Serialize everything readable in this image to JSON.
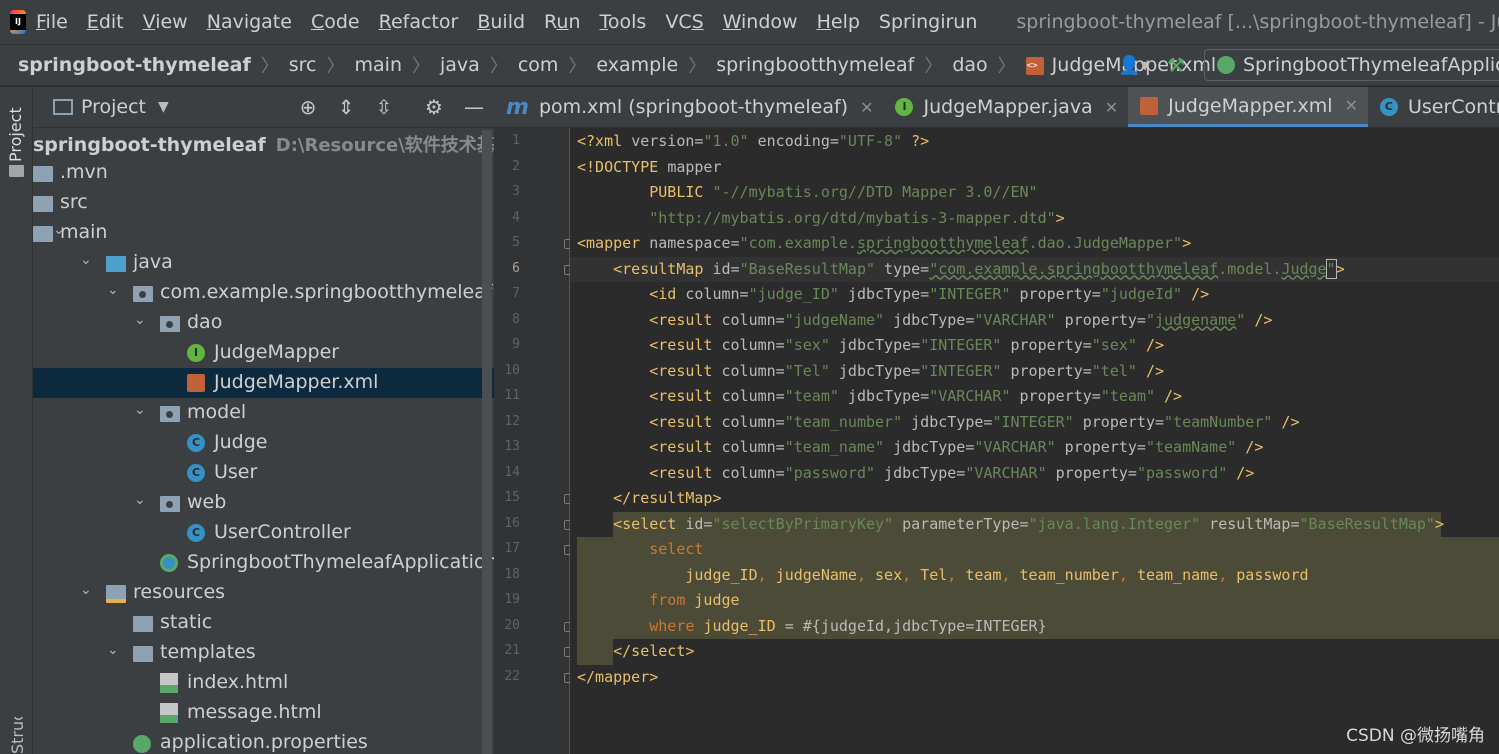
{
  "menubar": {
    "items": [
      {
        "pre": "",
        "u": "F",
        "post": "ile"
      },
      {
        "pre": "",
        "u": "E",
        "post": "dit"
      },
      {
        "pre": "",
        "u": "V",
        "post": "iew"
      },
      {
        "pre": "",
        "u": "N",
        "post": "avigate"
      },
      {
        "pre": "",
        "u": "C",
        "post": "ode"
      },
      {
        "pre": "",
        "u": "R",
        "post": "efactor"
      },
      {
        "pre": "",
        "u": "B",
        "post": "uild"
      },
      {
        "pre": "R",
        "u": "u",
        "post": "n"
      },
      {
        "pre": "",
        "u": "T",
        "post": "ools"
      },
      {
        "pre": "VC",
        "u": "S",
        "post": ""
      },
      {
        "pre": "",
        "u": "W",
        "post": "indow"
      },
      {
        "pre": "",
        "u": "H",
        "post": "elp"
      },
      {
        "pre": "Springirun",
        "u": "",
        "post": ""
      }
    ],
    "window_title": "springboot-thymeleaf [...\\springboot-thymeleaf] - JudgeMapper.xml"
  },
  "breadcrumb": [
    "springboot-thymeleaf",
    "src",
    "main",
    "java",
    "com",
    "example",
    "springbootthymeleaf",
    "dao",
    "JudgeMapper.xml"
  ],
  "run_config": "SpringbootThymeleafApplication",
  "strip": {
    "project": "Project",
    "structure": "Structure"
  },
  "project_panel": {
    "title": "Project",
    "tree": [
      {
        "label": "springboot-thymeleaf",
        "path": "D:\\Resource\\软件技术基础\\java",
        "indent": 0,
        "arrow": "",
        "icon": "none",
        "bold": true
      },
      {
        "label": ".mvn",
        "indent": 0,
        "arrow": "",
        "icon": "folder"
      },
      {
        "label": "src",
        "indent": 0,
        "arrow": "",
        "icon": "folder"
      },
      {
        "label": "main",
        "indent": 0,
        "arrow": "⌄",
        "icon": "folder"
      },
      {
        "label": "java",
        "indent": 1,
        "arrow": "⌄",
        "icon": "folder-blue"
      },
      {
        "label": "com.example.springbootthymeleaf",
        "indent": 2,
        "arrow": "⌄",
        "icon": "pkg"
      },
      {
        "label": "dao",
        "indent": 3,
        "arrow": "⌄",
        "icon": "pkg"
      },
      {
        "label": "JudgeMapper",
        "indent": 4,
        "arrow": "",
        "icon": "iface"
      },
      {
        "label": "JudgeMapper.xml",
        "indent": 4,
        "arrow": "",
        "icon": "xml",
        "selected": true
      },
      {
        "label": "model",
        "indent": 3,
        "arrow": "⌄",
        "icon": "pkg"
      },
      {
        "label": "Judge",
        "indent": 4,
        "arrow": "",
        "icon": "cls"
      },
      {
        "label": "User",
        "indent": 4,
        "arrow": "",
        "icon": "cls"
      },
      {
        "label": "web",
        "indent": 3,
        "arrow": "⌄",
        "icon": "pkg"
      },
      {
        "label": "UserController",
        "indent": 4,
        "arrow": "",
        "icon": "cls"
      },
      {
        "label": "SpringbootThymeleafApplication",
        "indent": 3,
        "arrow": "",
        "icon": "app"
      },
      {
        "label": "resources",
        "indent": 1,
        "arrow": "⌄",
        "icon": "res"
      },
      {
        "label": "static",
        "indent": 2,
        "arrow": "",
        "icon": "folder"
      },
      {
        "label": "templates",
        "indent": 2,
        "arrow": "⌄",
        "icon": "folder"
      },
      {
        "label": "index.html",
        "indent": 3,
        "arrow": "",
        "icon": "html"
      },
      {
        "label": "message.html",
        "indent": 3,
        "arrow": "",
        "icon": "html"
      },
      {
        "label": "application.properties",
        "indent": 2,
        "arrow": "",
        "icon": "props"
      }
    ]
  },
  "editor": {
    "tabs": [
      {
        "label": "pom.xml (springboot-thymeleaf)",
        "icon": "m",
        "active": false
      },
      {
        "label": "JudgeMapper.java",
        "icon": "iface",
        "active": false
      },
      {
        "label": "JudgeMapper.xml",
        "icon": "xml",
        "active": true
      },
      {
        "label": "UserController.java",
        "icon": "cls",
        "active": false
      }
    ],
    "current_line": 6,
    "highlight_lines": [
      17,
      20
    ],
    "lines": [
      {
        "n": "1",
        "segs": [
          [
            "t",
            "<?xml "
          ],
          [
            "a",
            "version="
          ],
          [
            "v",
            "\"1.0\""
          ],
          [
            "a",
            " encoding="
          ],
          [
            "v",
            "\"UTF-8\""
          ],
          [
            "t",
            " ?>"
          ]
        ]
      },
      {
        "n": "2",
        "segs": [
          [
            "t",
            "<!DOCTYPE "
          ],
          [
            "a",
            "mapper"
          ]
        ]
      },
      {
        "n": "3",
        "segs": [
          [
            "a",
            "        "
          ],
          [
            "t",
            "PUBLIC "
          ],
          [
            "v",
            "\"-//mybatis.org//DTD Mapper 3.0//EN\""
          ]
        ]
      },
      {
        "n": "4",
        "segs": [
          [
            "a",
            "        "
          ],
          [
            "v",
            "\"http://mybatis.org/dtd/mybatis-3-mapper.dtd\""
          ],
          [
            "t",
            ">"
          ]
        ]
      },
      {
        "n": "5",
        "segs": [
          [
            "t",
            "<mapper "
          ],
          [
            "a",
            "namespace="
          ],
          [
            "v",
            "\"com.example."
          ],
          [
            "vs",
            "springbootthymeleaf"
          ],
          [
            "v",
            ".dao.JudgeMapper\""
          ],
          [
            "t",
            ">"
          ]
        ]
      },
      {
        "n": "6",
        "segs": [
          [
            "a",
            "    "
          ],
          [
            "t",
            "<resultMap "
          ],
          [
            "a",
            "id="
          ],
          [
            "v",
            "\"BaseResultMap\""
          ],
          [
            "a",
            " type="
          ],
          [
            "vs",
            "\"com.example."
          ],
          [
            "vs",
            "springbootthymeleaf"
          ],
          [
            "v",
            ".model."
          ],
          [
            "vs",
            "Judge"
          ],
          [
            "vc",
            "\""
          ],
          [
            "t",
            ">"
          ]
        ]
      },
      {
        "n": "7",
        "segs": [
          [
            "a",
            "        "
          ],
          [
            "t",
            "<id "
          ],
          [
            "a",
            "column="
          ],
          [
            "v",
            "\"judge_ID\""
          ],
          [
            "a",
            " jdbcType="
          ],
          [
            "v",
            "\"INTEGER\""
          ],
          [
            "a",
            " property="
          ],
          [
            "v",
            "\"judgeId\""
          ],
          [
            "t",
            " />"
          ]
        ]
      },
      {
        "n": "8",
        "segs": [
          [
            "a",
            "        "
          ],
          [
            "t",
            "<result "
          ],
          [
            "a",
            "column="
          ],
          [
            "v",
            "\"judgeName\""
          ],
          [
            "a",
            " jdbcType="
          ],
          [
            "v",
            "\"VARCHAR\""
          ],
          [
            "a",
            " property="
          ],
          [
            "v",
            "\""
          ],
          [
            "vs",
            "judgename"
          ],
          [
            "v",
            "\""
          ],
          [
            "t",
            " />"
          ]
        ]
      },
      {
        "n": "9",
        "segs": [
          [
            "a",
            "        "
          ],
          [
            "t",
            "<result "
          ],
          [
            "a",
            "column="
          ],
          [
            "v",
            "\"sex\""
          ],
          [
            "a",
            " jdbcType="
          ],
          [
            "v",
            "\"INTEGER\""
          ],
          [
            "a",
            " property="
          ],
          [
            "v",
            "\"sex\""
          ],
          [
            "t",
            " />"
          ]
        ]
      },
      {
        "n": "10",
        "segs": [
          [
            "a",
            "        "
          ],
          [
            "t",
            "<result "
          ],
          [
            "a",
            "column="
          ],
          [
            "v",
            "\"Tel\""
          ],
          [
            "a",
            " jdbcType="
          ],
          [
            "v",
            "\"INTEGER\""
          ],
          [
            "a",
            " property="
          ],
          [
            "v",
            "\"tel\""
          ],
          [
            "t",
            " />"
          ]
        ]
      },
      {
        "n": "11",
        "segs": [
          [
            "a",
            "        "
          ],
          [
            "t",
            "<result "
          ],
          [
            "a",
            "column="
          ],
          [
            "v",
            "\"team\""
          ],
          [
            "a",
            " jdbcType="
          ],
          [
            "v",
            "\"VARCHAR\""
          ],
          [
            "a",
            " property="
          ],
          [
            "v",
            "\"team\""
          ],
          [
            "t",
            " />"
          ]
        ]
      },
      {
        "n": "12",
        "segs": [
          [
            "a",
            "        "
          ],
          [
            "t",
            "<result "
          ],
          [
            "a",
            "column="
          ],
          [
            "v",
            "\"team_number\""
          ],
          [
            "a",
            " jdbcType="
          ],
          [
            "v",
            "\"INTEGER\""
          ],
          [
            "a",
            " property="
          ],
          [
            "v",
            "\"teamNumber\""
          ],
          [
            "t",
            " />"
          ]
        ]
      },
      {
        "n": "13",
        "segs": [
          [
            "a",
            "        "
          ],
          [
            "t",
            "<result "
          ],
          [
            "a",
            "column="
          ],
          [
            "v",
            "\"team_name\""
          ],
          [
            "a",
            " jdbcType="
          ],
          [
            "v",
            "\"VARCHAR\""
          ],
          [
            "a",
            " property="
          ],
          [
            "v",
            "\"teamName\""
          ],
          [
            "t",
            " />"
          ]
        ]
      },
      {
        "n": "14",
        "segs": [
          [
            "a",
            "        "
          ],
          [
            "t",
            "<result "
          ],
          [
            "a",
            "column="
          ],
          [
            "v",
            "\"password\""
          ],
          [
            "a",
            " jdbcType="
          ],
          [
            "v",
            "\"VARCHAR\""
          ],
          [
            "a",
            " property="
          ],
          [
            "v",
            "\"password\""
          ],
          [
            "t",
            " />"
          ]
        ]
      },
      {
        "n": "15",
        "segs": [
          [
            "a",
            "    "
          ],
          [
            "t",
            "</resultMap>"
          ]
        ]
      },
      {
        "n": "16",
        "segs": [
          [
            "a",
            "    "
          ],
          [
            "t",
            "<select "
          ],
          [
            "a",
            "id="
          ],
          [
            "v",
            "\"selectByPrimaryKey\""
          ],
          [
            "a",
            " parameterType="
          ],
          [
            "v",
            "\"java.lang.Integer\""
          ],
          [
            "a",
            " resultMap="
          ],
          [
            "v",
            "\"BaseResultMap\""
          ],
          [
            "t",
            ">"
          ]
        ]
      },
      {
        "n": "17",
        "segs": [
          [
            "a",
            "        "
          ],
          [
            "k",
            "select"
          ]
        ]
      },
      {
        "n": "18",
        "segs": [
          [
            "a",
            "            "
          ],
          [
            "p",
            "judge_ID"
          ],
          [
            "k",
            ", "
          ],
          [
            "p",
            "judgeName"
          ],
          [
            "k",
            ", "
          ],
          [
            "p",
            "sex"
          ],
          [
            "k",
            ", "
          ],
          [
            "p",
            "Tel"
          ],
          [
            "k",
            ", "
          ],
          [
            "p",
            "team"
          ],
          [
            "k",
            ", "
          ],
          [
            "p",
            "team_number"
          ],
          [
            "k",
            ", "
          ],
          [
            "p",
            "team_name"
          ],
          [
            "k",
            ", "
          ],
          [
            "p",
            "password"
          ]
        ]
      },
      {
        "n": "19",
        "segs": [
          [
            "a",
            "        "
          ],
          [
            "k",
            "from "
          ],
          [
            "p",
            "judge"
          ]
        ]
      },
      {
        "n": "20",
        "segs": [
          [
            "a",
            "        "
          ],
          [
            "k",
            "where "
          ],
          [
            "p",
            "judge_ID"
          ],
          [
            "a",
            " = #{judgeId,jdbcType=INTEGER}"
          ]
        ]
      },
      {
        "n": "21",
        "segs": [
          [
            "a",
            "    "
          ],
          [
            "t",
            "</select>"
          ]
        ]
      },
      {
        "n": "22",
        "segs": [
          [
            "t",
            "</mapper>"
          ]
        ]
      }
    ],
    "fold_lines": [
      5,
      6,
      15,
      16,
      17,
      20,
      21,
      22
    ]
  },
  "watermark": "CSDN @微扬嘴角",
  "colors": {
    "tag": "#e8bf6a",
    "attr": "#bababa",
    "value": "#6a8759",
    "keyword": "#cc7832",
    "selection": "#0d293e",
    "accent": "#4a88c7"
  }
}
